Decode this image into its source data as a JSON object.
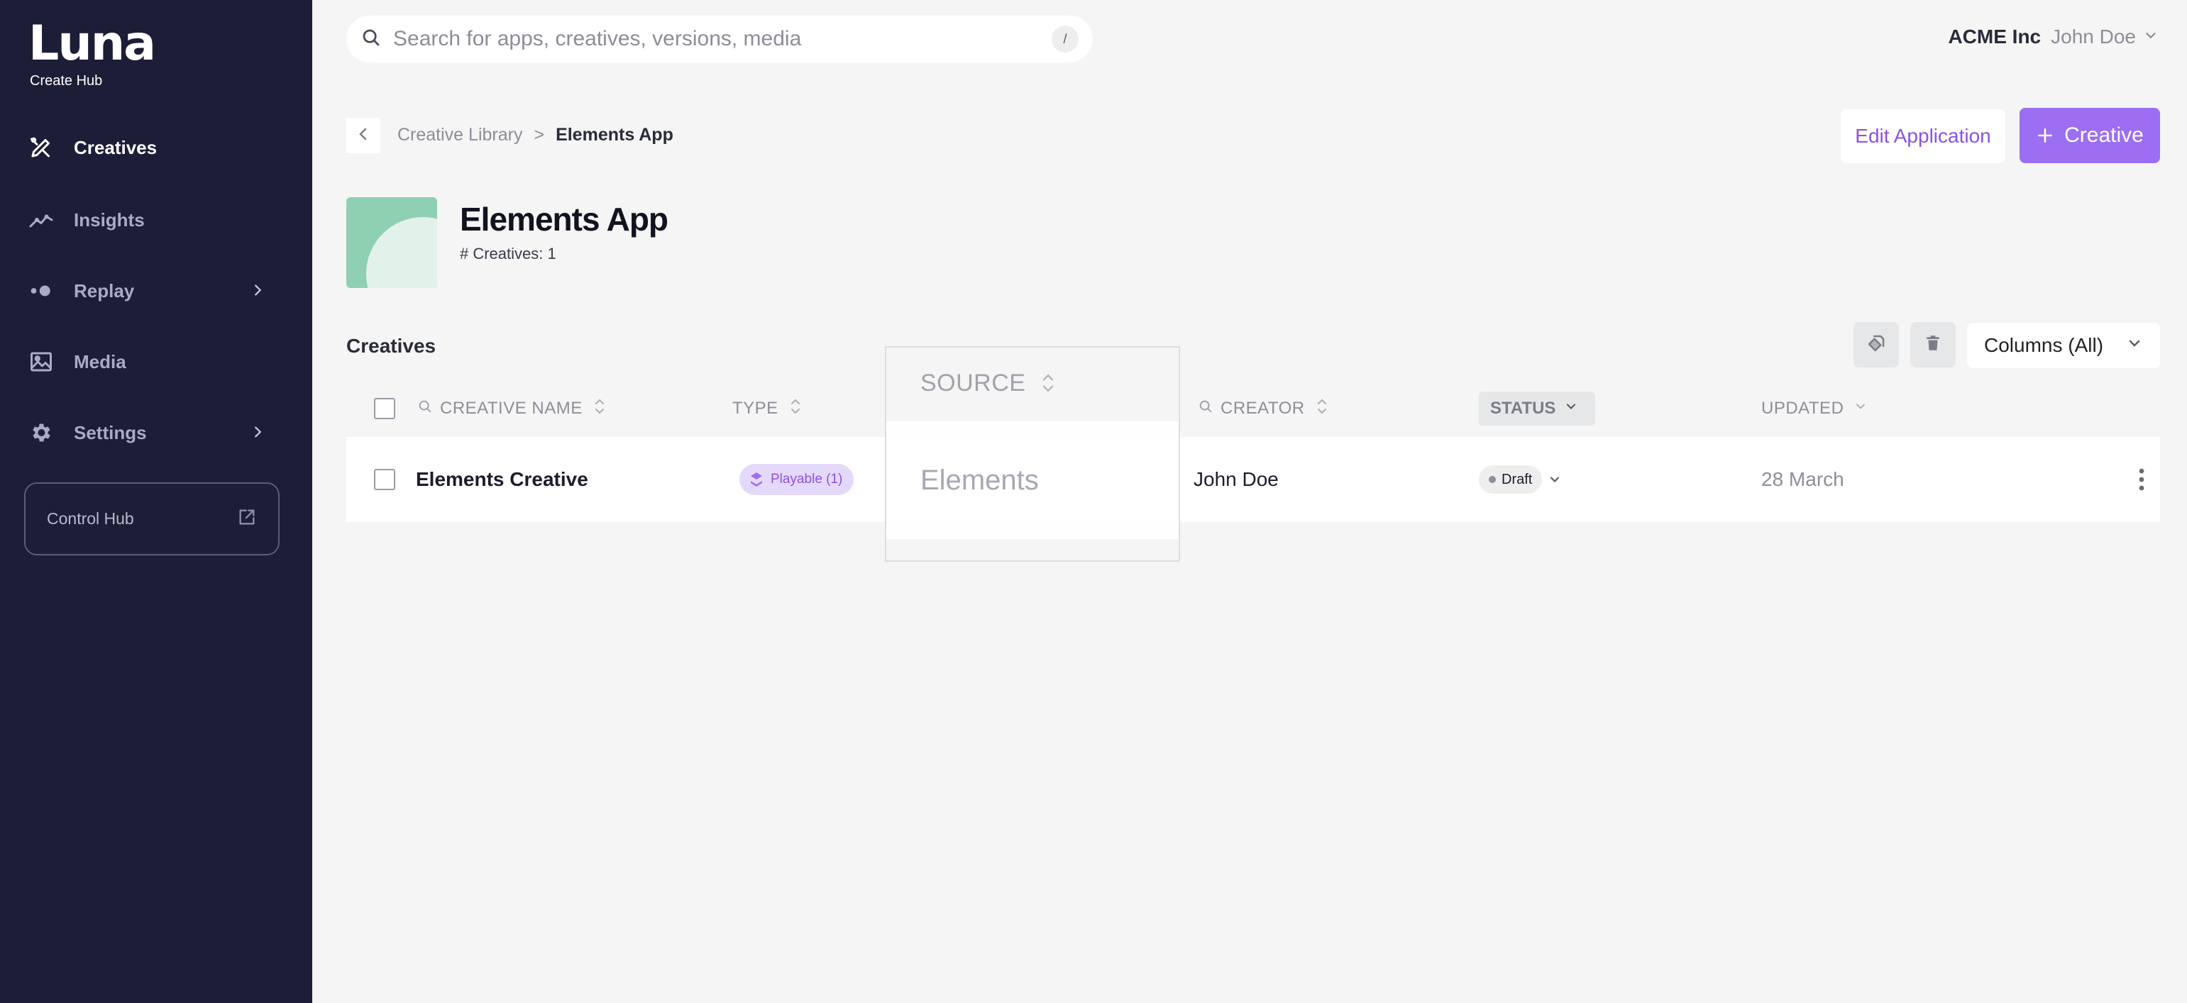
{
  "brand": {
    "logo": "Luna",
    "subtitle": "Create Hub"
  },
  "sidebar": {
    "items": [
      {
        "label": "Creatives",
        "icon": "creatives-icon",
        "active": true
      },
      {
        "label": "Insights",
        "icon": "insights-icon",
        "active": false
      },
      {
        "label": "Replay",
        "icon": "replay-icon",
        "active": false,
        "has_submenu": true
      },
      {
        "label": "Media",
        "icon": "media-icon",
        "active": false
      },
      {
        "label": "Settings",
        "icon": "gear-icon",
        "active": false,
        "has_submenu": true
      }
    ],
    "control_hub": {
      "label": "Control Hub",
      "icon": "external-link-icon"
    }
  },
  "search": {
    "placeholder": "Search for apps, creatives, versions, media",
    "value": "",
    "shortcut": "/"
  },
  "account": {
    "org": "ACME Inc",
    "user": "John Doe"
  },
  "breadcrumb": {
    "parent": "Creative Library",
    "separator": ">",
    "current": "Elements App"
  },
  "actions": {
    "edit_label": "Edit Application",
    "create_label": "Creative"
  },
  "app": {
    "title": "Elements App",
    "count_text": "# Creatives: 1"
  },
  "section": {
    "title": "Creatives",
    "columns_label": "Columns (All)"
  },
  "table": {
    "columns": {
      "name": "CREATIVE NAME",
      "type": "TYPE",
      "source": "SOURCE",
      "creator": "CREATOR",
      "status": "STATUS",
      "updated": "UPDATED"
    },
    "rows": [
      {
        "name": "Elements Creative",
        "type": "Playable (1)",
        "source": "Elements",
        "creator": "John Doe",
        "status": "Draft",
        "updated": "28 March"
      }
    ]
  },
  "colors": {
    "sidebar_bg": "#1c1d36",
    "accent": "#9c6ef2",
    "accent_text": "#8b52e0",
    "page_bg": "#f4f5f4",
    "thumb": "#8fd0b2"
  }
}
